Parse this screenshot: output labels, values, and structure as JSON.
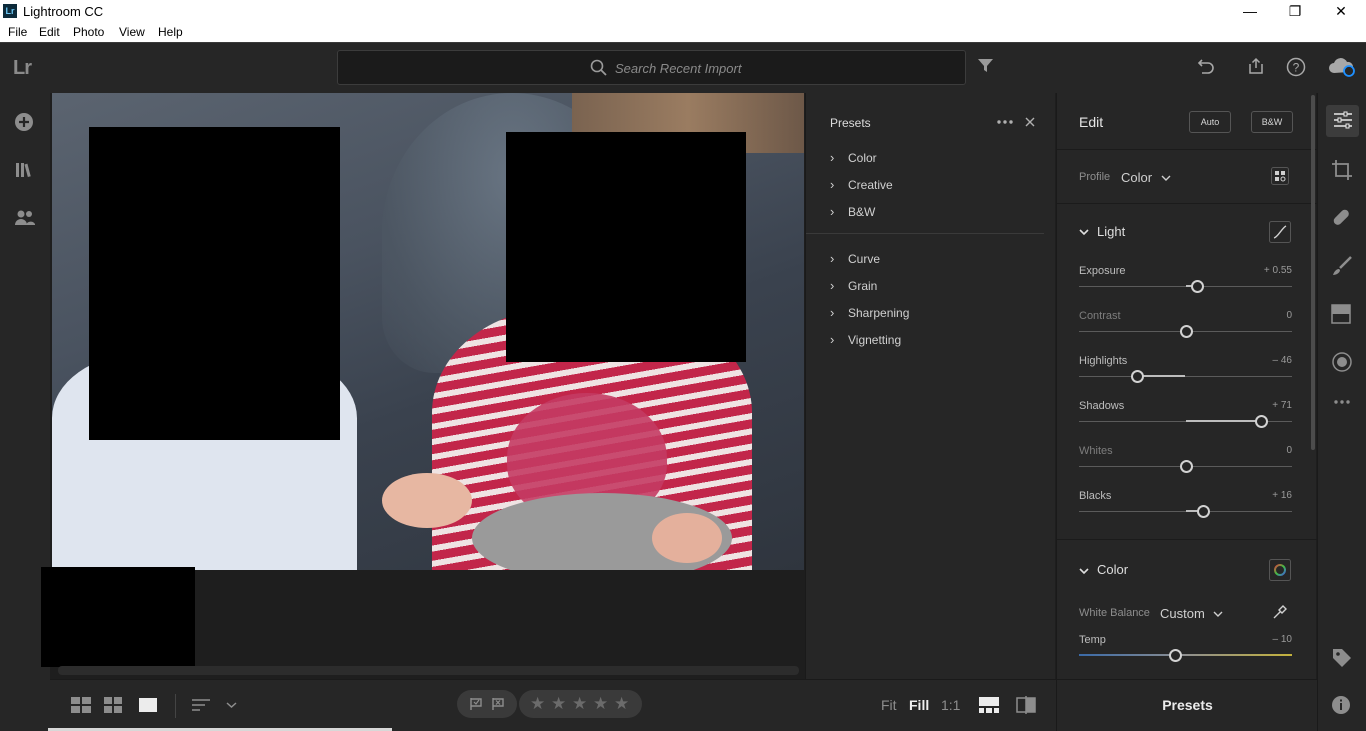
{
  "window": {
    "app_logo": "Lr",
    "title": "Lightroom CC",
    "controls": {
      "minimize": "—",
      "maximize": "❐",
      "close": "✕"
    }
  },
  "menu": [
    "File",
    "Edit",
    "Photo",
    "View",
    "Help"
  ],
  "toolbar": {
    "logo": "Lr",
    "search_placeholder": "Search Recent Import",
    "icons": [
      "filter-icon",
      "undo-icon",
      "share-icon",
      "help-icon",
      "cloud-sync-icon"
    ]
  },
  "left_rail": {
    "icons": [
      "add-photos-icon",
      "library-icon",
      "people-icon"
    ]
  },
  "presets": {
    "title": "Presets",
    "group1": [
      "Color",
      "Creative",
      "B&W"
    ],
    "group2": [
      "Curve",
      "Grain",
      "Sharpening",
      "Vignetting"
    ]
  },
  "edit": {
    "title": "Edit",
    "auto_label": "Auto",
    "bw_label": "B&W",
    "profile_label": "Profile",
    "profile_value": "Color",
    "light_title": "Light",
    "sliders": [
      {
        "name": "Exposure",
        "value": "+ 0.55",
        "level": 0.55,
        "min": -5,
        "max": 5,
        "dim": false
      },
      {
        "name": "Contrast",
        "value": "0",
        "level": 0,
        "min": -100,
        "max": 100,
        "dim": true
      },
      {
        "name": "Highlights",
        "value": "– 46",
        "level": -46,
        "min": -100,
        "max": 100,
        "dim": false
      },
      {
        "name": "Shadows",
        "value": "+ 71",
        "level": 71,
        "min": -100,
        "max": 100,
        "dim": false
      },
      {
        "name": "Whites",
        "value": "0",
        "level": 0,
        "min": -100,
        "max": 100,
        "dim": true
      },
      {
        "name": "Blacks",
        "value": "+ 16",
        "level": 16,
        "min": -100,
        "max": 100,
        "dim": false
      }
    ],
    "color_title": "Color",
    "white_balance_label": "White Balance",
    "white_balance_value": "Custom",
    "temp": {
      "name": "Temp",
      "value": "– 10",
      "level": -10,
      "min": -100,
      "max": 100
    }
  },
  "bottom": {
    "fit_label": "Fit",
    "fill_label": "Fill",
    "one_to_one_label": "1:1",
    "presets_label": "Presets",
    "stars": [
      "★",
      "★",
      "★",
      "★",
      "★"
    ]
  },
  "right_rail": {
    "icons": [
      "edit-sliders-icon",
      "crop-icon",
      "healing-icon",
      "brush-icon",
      "linear-gradient-icon",
      "radial-gradient-icon",
      "more-icon",
      "tag-icon",
      "info-icon"
    ]
  },
  "colors": {
    "panel_bg": "#262626",
    "canvas_bg": "#1e1e1e",
    "text": "#d0d0d0",
    "accent": "#1e90ff"
  }
}
